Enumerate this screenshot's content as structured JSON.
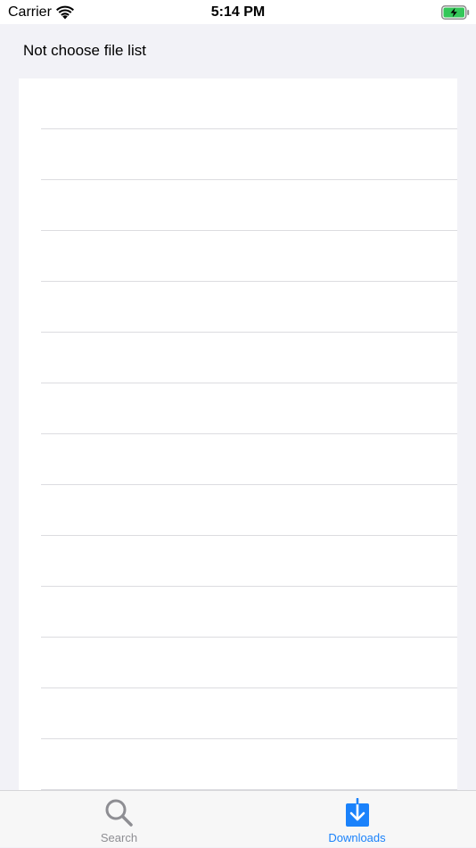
{
  "status_bar": {
    "carrier": "Carrier",
    "time": "5:14 PM",
    "icons": [
      "wifi-icon",
      "battery-charging-icon"
    ],
    "battery_color": "#34c759"
  },
  "header": {
    "title": "Not choose file list"
  },
  "file_list": {
    "rows": [
      "",
      "",
      "",
      "",
      "",
      "",
      "",
      "",
      "",
      "",
      "",
      "",
      "",
      ""
    ]
  },
  "tab_bar": {
    "tabs": [
      {
        "label": "Search",
        "icon": "magnifying-glass-icon",
        "selected": false,
        "color": "#8e8e93"
      },
      {
        "label": "Downloads",
        "icon": "download-tray-icon",
        "selected": true,
        "color": "#1a82fb"
      }
    ]
  }
}
